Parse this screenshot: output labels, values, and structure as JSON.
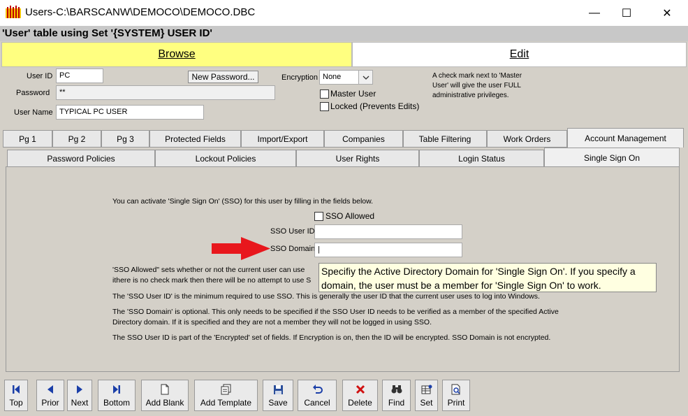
{
  "window": {
    "title": "Users-C:\\BARSCANW\\DEMOCO\\DEMOCO.DBC",
    "minimize": "—",
    "maximize": "☐",
    "close": "✕"
  },
  "heading": "'User' table using Set '{SYSTEM} USER ID'",
  "modes": {
    "browse": "Browse",
    "edit": "Edit"
  },
  "form": {
    "user_id_label": "User ID",
    "user_id_value": "PC",
    "new_password_label": "New Password...",
    "password_label": "Password",
    "password_value": "**",
    "user_name_label": "User Name",
    "user_name_value": "TYPICAL PC USER",
    "encryption_label": "Encryption",
    "encryption_value": "None",
    "master_user_label": "Master User",
    "locked_label": "Locked (Prevents Edits)",
    "note": "A check mark next to 'Master User' will give the user FULL administrative privileges."
  },
  "tabs": [
    "Pg 1",
    "Pg 2",
    "Pg 3",
    "Protected Fields",
    "Import/Export",
    "Companies",
    "Table Filtering",
    "Work Orders",
    "Account Management"
  ],
  "subtabs": [
    "Password Policies",
    "Lockout Policies",
    "User Rights",
    "Login Status",
    "Single Sign On"
  ],
  "sso": {
    "intro": "You can activate 'Single Sign On' (SSO) for this user by filling in the fields below.",
    "allowed_label": "SSO Allowed",
    "user_id_label": "SSO User ID",
    "user_id_value": "",
    "domain_label": "SSO Domain",
    "domain_value": "|",
    "p1_line1": "'SSO Allowed\"  sets whether or not the current user can use",
    "p1_line2": "ithere is no check mark then there will be no attempt to use S",
    "p2": "The 'SSO User ID' is the minimum required to use SSO. This is generally the user ID that the current user uses to log into Windows.",
    "p3_line1": "The 'SSO Domain' is optional. This only needs to be specified if the SSO User ID needs to be verified as a member of the specified Active",
    "p3_line2": "Directory domain. If it is specified and they are not a member they will not be logged in using SSO.",
    "p4": "The SSO User ID is part of the 'Encrypted' set of fields.  If Encryption is on, then the ID will be encrypted.  SSO Domain is not encrypted."
  },
  "tooltip": "Specifiy the Active Directory Domain for 'Single Sign On'. If you specify a domain, the user must be a member for 'Single Sign On' to work.",
  "toolbar": [
    "Top",
    "Prior",
    "Next",
    "Bottom",
    "Add Blank",
    "Add Template",
    "Save",
    "Cancel",
    "Delete",
    "Find",
    "Set",
    "Print"
  ],
  "colors": {
    "browse_bg": "#ffff80",
    "tooltip_bg": "#ffffe1",
    "arrow": "#e8171d"
  }
}
